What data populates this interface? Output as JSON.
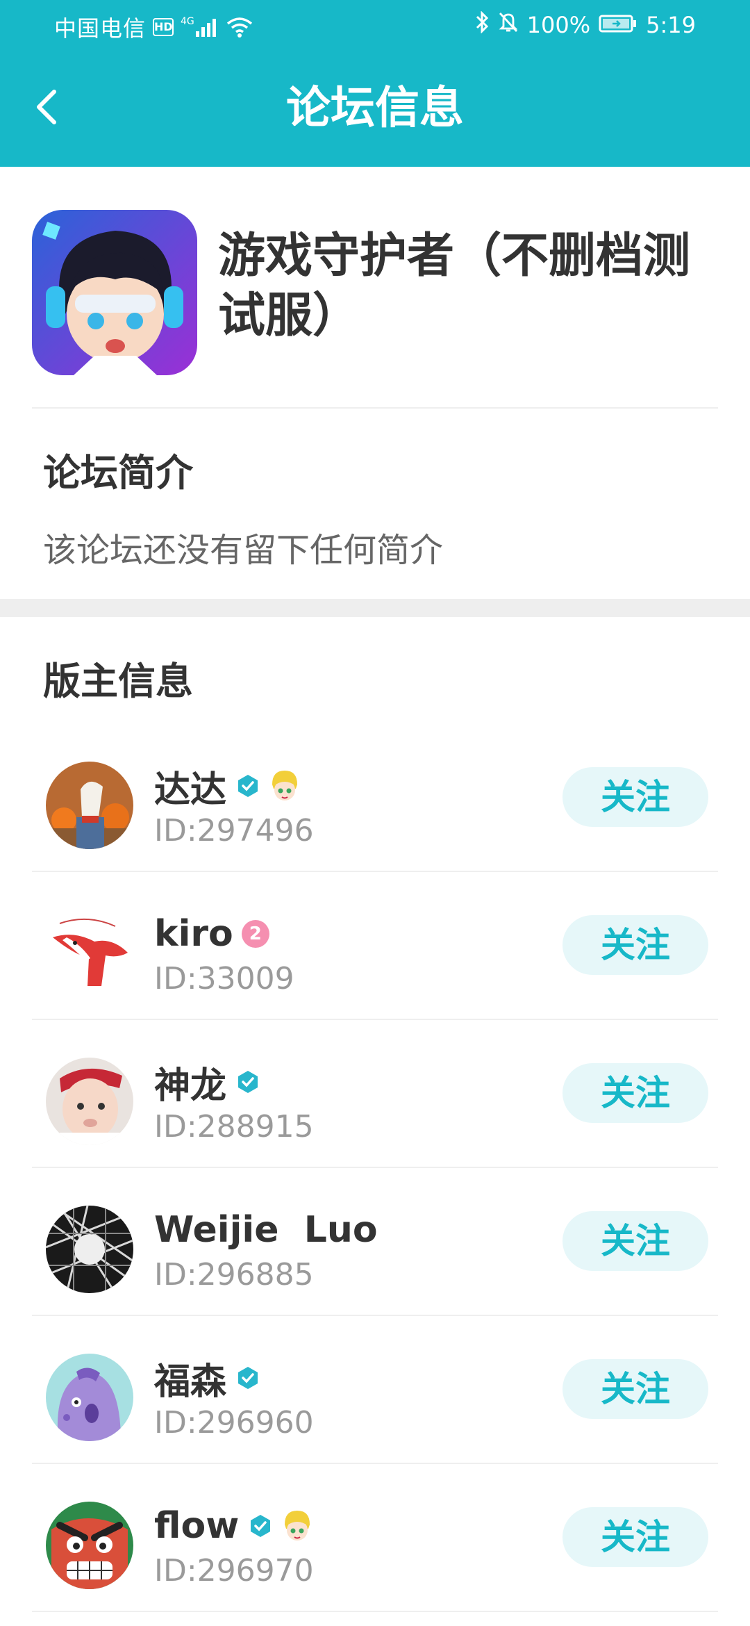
{
  "status_bar": {
    "carrier": "中国电信",
    "hd": "HD",
    "network": "4G",
    "battery": "100%",
    "time": "5:19"
  },
  "title_bar": {
    "title": "论坛信息"
  },
  "forum": {
    "name": "游戏守护者（不删档测试服）"
  },
  "intro": {
    "title": "论坛简介",
    "text": "该论坛还没有留下任何简介"
  },
  "moderators": {
    "title": "版主信息",
    "follow_label": "关注",
    "items": [
      {
        "name": "达达",
        "id": "ID:297496",
        "verified": true,
        "char_badge": true,
        "level": null
      },
      {
        "name": "kiro",
        "id": "ID:33009",
        "verified": false,
        "char_badge": false,
        "level": "2"
      },
      {
        "name": "神龙",
        "id": "ID:288915",
        "verified": true,
        "char_badge": false,
        "level": null
      },
      {
        "name": "Weijie  Luo",
        "id": "ID:296885",
        "verified": false,
        "char_badge": false,
        "level": null
      },
      {
        "name": "福森",
        "id": "ID:296960",
        "verified": true,
        "char_badge": false,
        "level": null
      },
      {
        "name": "flow",
        "id": "ID:296970",
        "verified": true,
        "char_badge": true,
        "level": null
      }
    ]
  },
  "colors": {
    "accent": "#17b8c8",
    "follow_bg": "#e6f7f9",
    "text_dark": "#333333",
    "text_gray": "#9a9a9a"
  }
}
